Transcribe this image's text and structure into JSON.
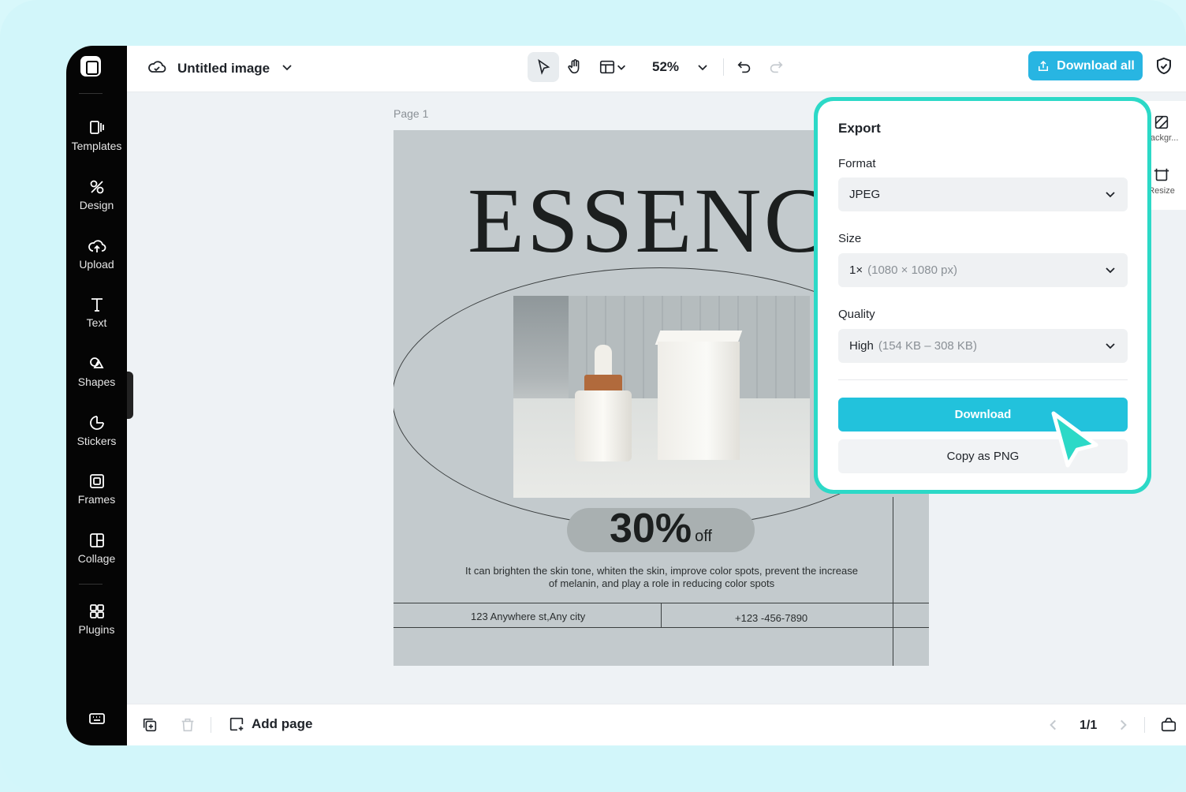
{
  "header": {
    "doc_title": "Untitled image",
    "zoom": "52%",
    "download_all_label": "Download all"
  },
  "sidebar": {
    "items": [
      {
        "label": "Templates",
        "icon": "templates-icon"
      },
      {
        "label": "Design",
        "icon": "design-icon"
      },
      {
        "label": "Upload",
        "icon": "upload-icon"
      },
      {
        "label": "Text",
        "icon": "text-icon"
      },
      {
        "label": "Shapes",
        "icon": "shapes-icon"
      },
      {
        "label": "Stickers",
        "icon": "stickers-icon"
      },
      {
        "label": "Frames",
        "icon": "frames-icon"
      },
      {
        "label": "Collage",
        "icon": "collage-icon"
      },
      {
        "label": "Plugins",
        "icon": "plugins-icon"
      }
    ]
  },
  "canvas": {
    "page_label": "Page 1",
    "poster": {
      "title": "ESSENCE",
      "discount": "30%",
      "discount_suffix": "off",
      "description": "It can brighten the skin tone, whiten the skin, improve color spots, prevent the increase of melanin, and play a role in reducing color spots",
      "address": "123 Anywhere st,Any city",
      "phone": "+123 -456-7890"
    }
  },
  "right_panel": {
    "items": [
      {
        "label": "Backgr...",
        "icon": "background-icon"
      },
      {
        "label": "Resize",
        "icon": "resize-icon"
      }
    ]
  },
  "export": {
    "title": "Export",
    "format_label": "Format",
    "format_value": "JPEG",
    "size_label": "Size",
    "size_value": "1×",
    "size_detail": "(1080 × 1080 px)",
    "quality_label": "Quality",
    "quality_value": "High",
    "quality_detail": "(154 KB – 308 KB)",
    "download_label": "Download",
    "copy_label": "Copy as PNG"
  },
  "footer": {
    "add_page_label": "Add page",
    "pager": "1/1"
  },
  "colors": {
    "accent": "#22c2dc",
    "download_all": "#28b5e2",
    "highlight": "#2cd9c7"
  }
}
